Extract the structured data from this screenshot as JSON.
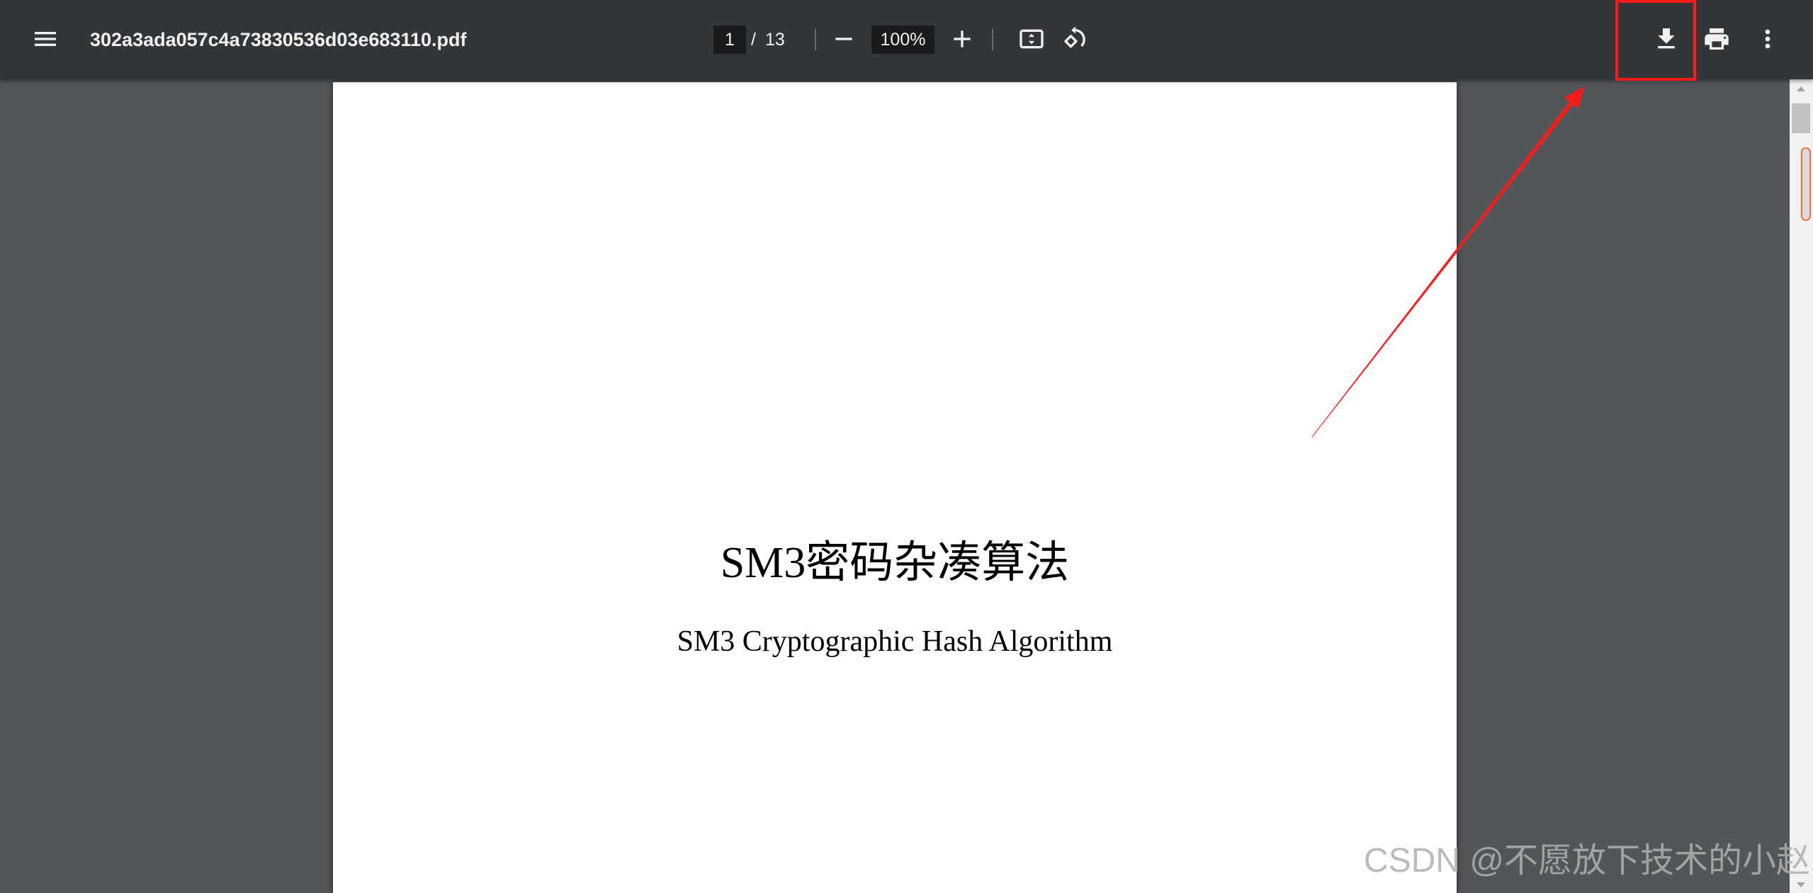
{
  "toolbar": {
    "filename": "302a3ada057c4a73830536d03e683110.pdf",
    "page": {
      "current": "1",
      "separator": "/",
      "total": "13"
    },
    "zoom": "100%",
    "icons": {
      "menu": "menu-icon",
      "zoom_out": "minus-icon",
      "zoom_in": "plus-icon",
      "fit": "fit-to-page-icon",
      "rotate": "rotate-counterclockwise-icon",
      "download": "download-icon",
      "print": "print-icon",
      "more": "more-vert-icon"
    }
  },
  "document": {
    "page_title": "SM3密码杂凑算法",
    "page_subtitle": "SM3 Cryptographic Hash Algorithm"
  },
  "watermark": "CSDN @不愿放下技术的小赵",
  "colors": {
    "toolbar_bg": "#323639",
    "viewer_bg": "#525659",
    "page_bg": "#ffffff",
    "icon": "#f1f1f1",
    "input_bg": "#191b1c",
    "annotation_red": "#ff1a1a"
  }
}
